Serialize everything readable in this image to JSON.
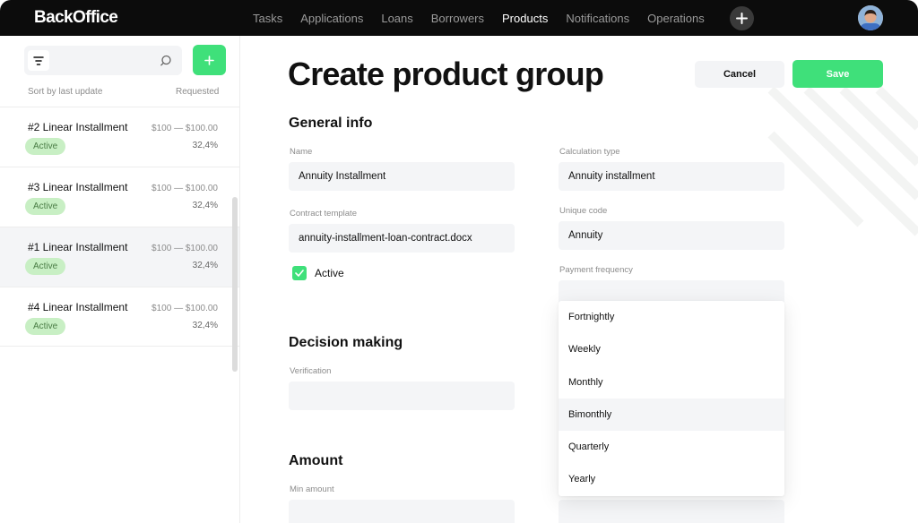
{
  "app": {
    "title": "BackOffice"
  },
  "nav": {
    "items": [
      {
        "label": "Tasks",
        "active": false
      },
      {
        "label": "Applications",
        "active": false
      },
      {
        "label": "Loans",
        "active": false
      },
      {
        "label": "Borrowers",
        "active": false
      },
      {
        "label": "Products",
        "active": true
      },
      {
        "label": "Notifications",
        "active": false
      },
      {
        "label": "Operations",
        "active": false
      }
    ],
    "plus_icon": "plus-icon",
    "avatar_icon": "user-avatar"
  },
  "sidebar": {
    "search": {
      "value": "",
      "placeholder": ""
    },
    "sort_label": "Sort by last update",
    "requested_label": "Requested",
    "items": [
      {
        "title": "#2 Linear Installment",
        "status": "Active",
        "range": "$100 — $100.00",
        "rate": "32,4%",
        "selected": false
      },
      {
        "title": "#3 Linear Installment",
        "status": "Active",
        "range": "$100 — $100.00",
        "rate": "32,4%",
        "selected": false
      },
      {
        "title": "#1 Linear Installment",
        "status": "Active",
        "range": "$100 — $100.00",
        "rate": "32,4%",
        "selected": true
      },
      {
        "title": "#4 Linear Installment",
        "status": "Active",
        "range": "$100 — $100.00",
        "rate": "32,4%",
        "selected": false
      }
    ]
  },
  "main": {
    "title": "Create product group",
    "cancel_label": "Cancel",
    "save_label": "Save",
    "general": {
      "title": "General info",
      "name_label": "Name",
      "name_value": "Annuity Installment",
      "calc_label": "Calculation type",
      "calc_value": "Annuity installment",
      "template_label": "Contract template",
      "template_value": "annuity-installment-loan-contract.docx",
      "code_label": "Unique code",
      "code_value": "Annuity",
      "active_label": "Active",
      "active_checked": true,
      "freq_label": "Payment frequency",
      "freq_value": ""
    },
    "freq_options": [
      "Fortnightly",
      "Weekly",
      "Monthly",
      "Bimonthly",
      "Quarterly",
      "Yearly"
    ],
    "freq_hovered": "Bimonthly",
    "decision": {
      "title": "Decision making",
      "verification_label": "Verification",
      "verification_value": ""
    },
    "amount": {
      "title": "Amount",
      "min_label": "Min amount",
      "min_value": ""
    }
  },
  "colors": {
    "accent": "#3fe07a",
    "badge_bg": "#c8efc4",
    "badge_text": "#4b7d46",
    "topbar": "#0c0c0c"
  }
}
